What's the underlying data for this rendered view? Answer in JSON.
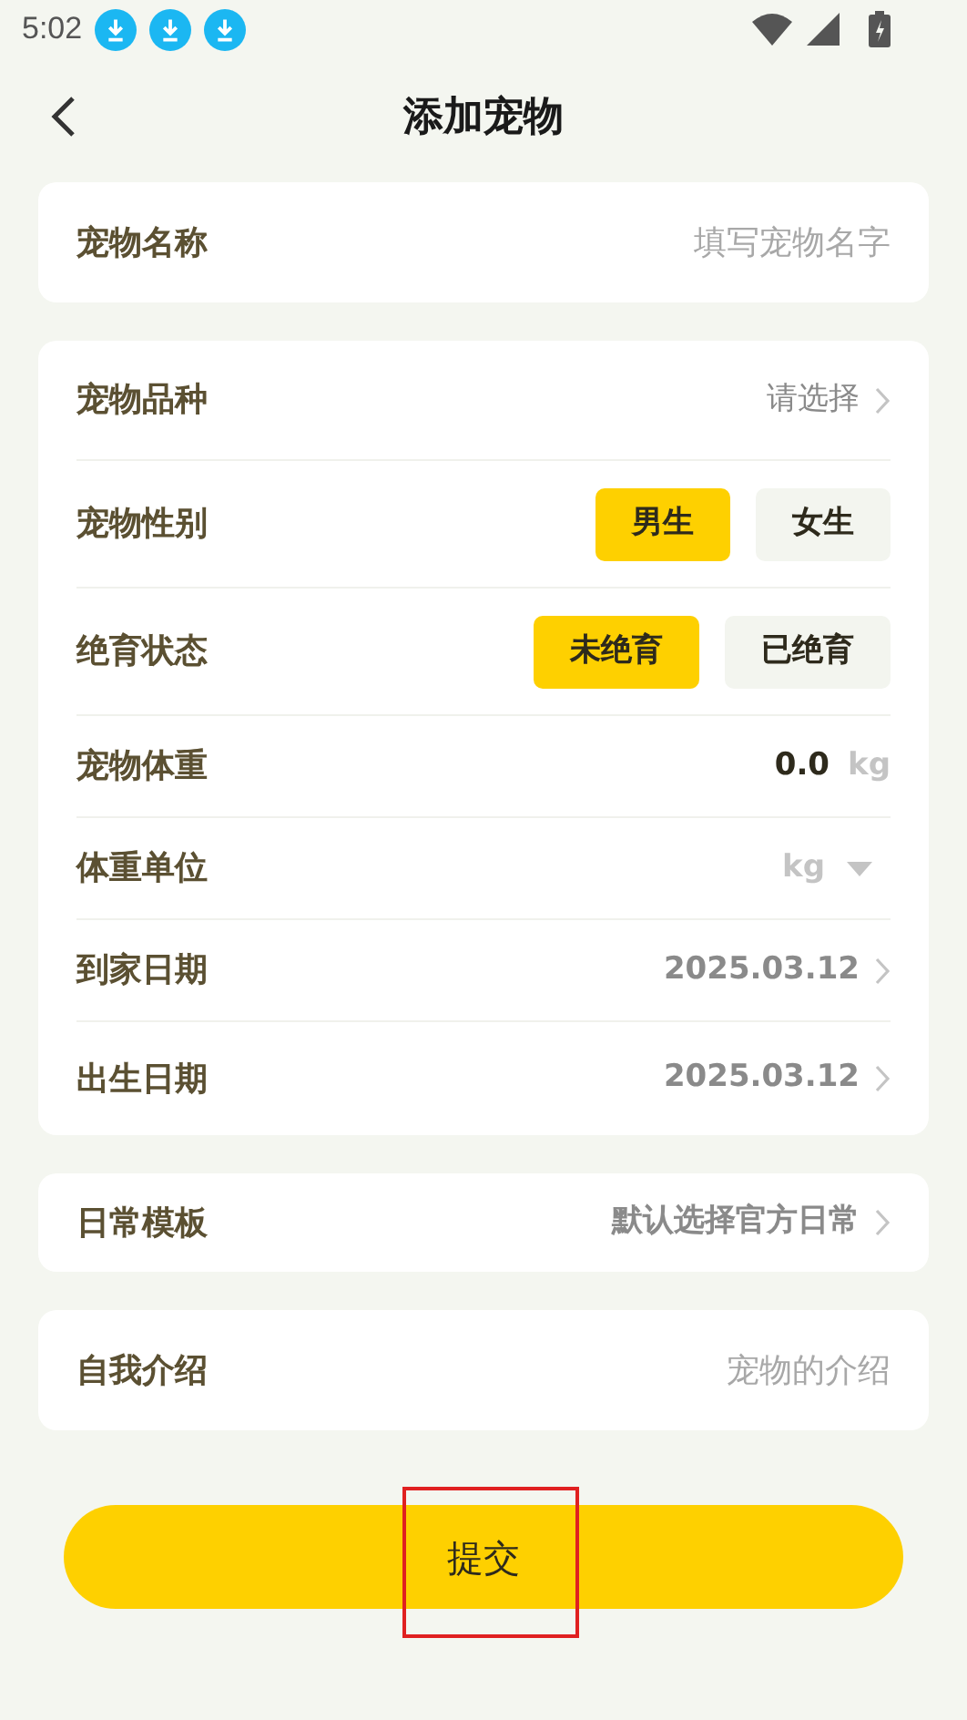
{
  "status_bar": {
    "time": "5:02"
  },
  "header": {
    "title": "添加宠物"
  },
  "sections": [
    {
      "rows": [
        {
          "kind": "text_input",
          "label": "宠物名称",
          "placeholder": "填写宠物名字"
        }
      ]
    },
    {
      "rows": [
        {
          "kind": "select",
          "label": "宠物品种",
          "placeholder": "请选择"
        },
        {
          "kind": "toggle",
          "label": "宠物性别",
          "options": [
            {
              "label": "男生",
              "selected": true
            },
            {
              "label": "女生",
              "selected": false
            }
          ]
        },
        {
          "kind": "toggle",
          "label": "绝育状态",
          "options": [
            {
              "label": "未绝育",
              "selected": true
            },
            {
              "label": "已绝育",
              "selected": false
            }
          ]
        },
        {
          "kind": "number",
          "label": "宠物体重",
          "value": "0.0",
          "unit": "kg"
        },
        {
          "kind": "dropdown",
          "label": "体重单位",
          "value": "kg"
        },
        {
          "kind": "select",
          "label": "到家日期",
          "value": "2025.03.12"
        },
        {
          "kind": "select",
          "label": "出生日期",
          "value": "2025.03.12"
        }
      ]
    },
    {
      "rows": [
        {
          "kind": "select",
          "label": "日常模板",
          "value": "默认选择官方日常"
        }
      ]
    },
    {
      "rows": [
        {
          "kind": "text_input",
          "label": "自我介绍",
          "placeholder": "宠物的介绍"
        }
      ]
    }
  ],
  "submit": {
    "label": "提交",
    "highlighted": true
  }
}
